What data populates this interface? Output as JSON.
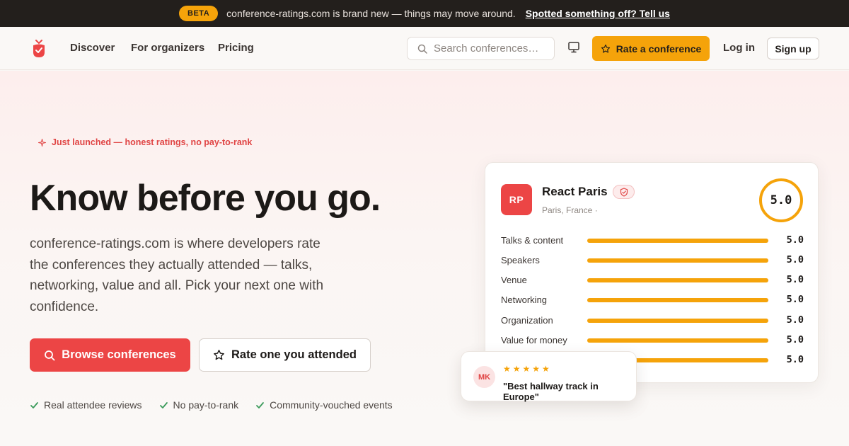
{
  "beta_bar": {
    "pill": "BETA",
    "message": "conference-ratings.com is brand new — things may move around.",
    "link": "Spotted something off? Tell us"
  },
  "nav": {
    "links": [
      "Discover",
      "For organizers",
      "Pricing"
    ],
    "search_placeholder": "Search conferences…",
    "rate_button": "Rate a conference",
    "login": "Log in",
    "signup": "Sign up"
  },
  "hero": {
    "badge": "Just launched — honest ratings, no pay-to-rank",
    "headline": "Know before you go.",
    "subtext": "conference-ratings.com is where developers rate the conferences they actually attended — talks, networking, value and all. Pick your next one with confidence.",
    "primary_button": "Browse conferences",
    "secondary_button": "Rate one you attended",
    "checks": [
      "Real attendee reviews",
      "No pay-to-rank",
      "Community-vouched events"
    ]
  },
  "card": {
    "initials": "RP",
    "name": "React Paris",
    "location": "Paris, France ·",
    "overall": "5.0",
    "ratings": [
      {
        "label": "Talks & content",
        "value": "5.0",
        "fraction": 1.0
      },
      {
        "label": "Speakers",
        "value": "5.0",
        "fraction": 1.0
      },
      {
        "label": "Venue",
        "value": "5.0",
        "fraction": 1.0
      },
      {
        "label": "Networking",
        "value": "5.0",
        "fraction": 1.0
      },
      {
        "label": "Organization",
        "value": "5.0",
        "fraction": 1.0
      },
      {
        "label": "Value for money",
        "value": "5.0",
        "fraction": 1.0
      },
      {
        "label": "",
        "value": "5.0",
        "fraction": 1.0
      }
    ]
  },
  "review": {
    "initials": "MK",
    "stars": "★★★★★",
    "quote": "\"Best hallway track in Europe\""
  },
  "colors": {
    "accent_red": "#ec4545",
    "accent_amber": "#f5a30a",
    "check_green": "#3a9a5a"
  }
}
